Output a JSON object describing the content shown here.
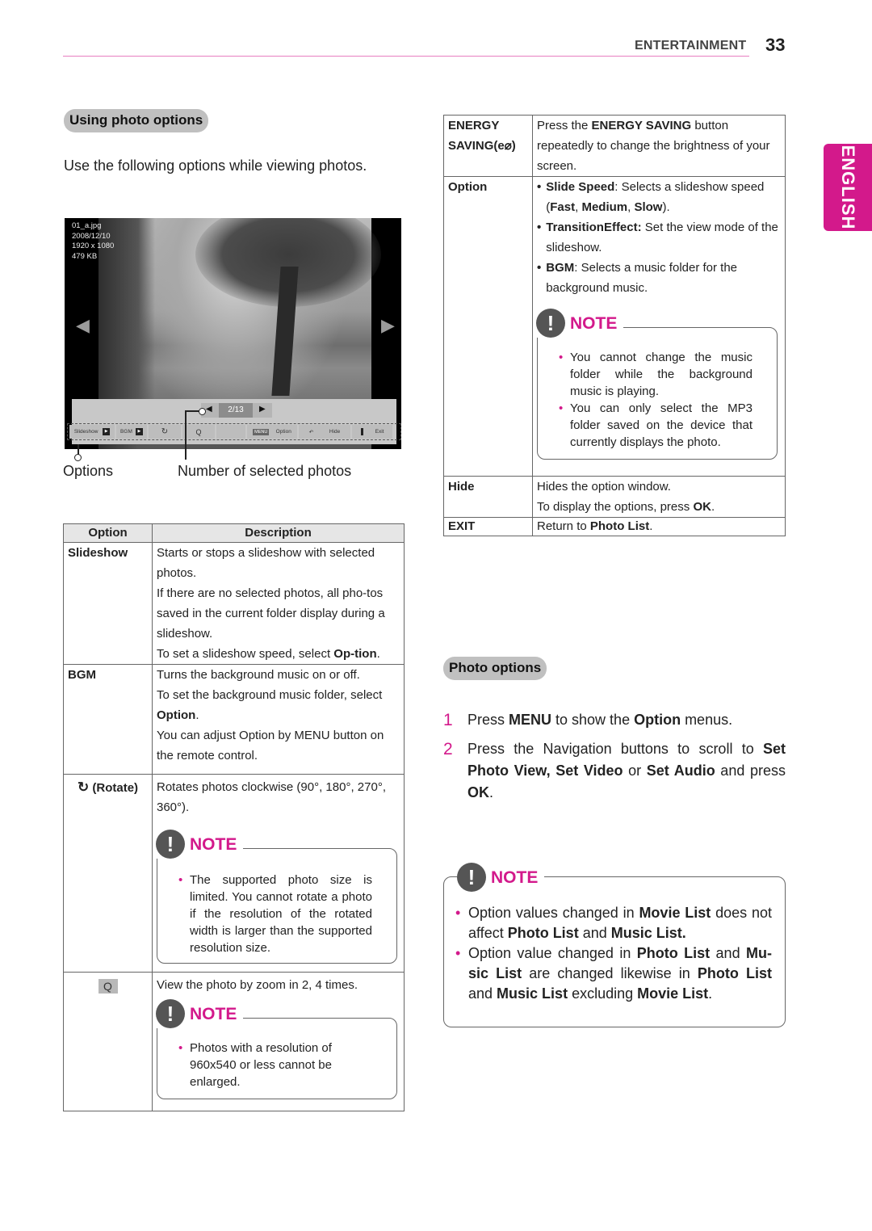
{
  "header": {
    "section": "ENTERTAINMENT",
    "page_number": "33",
    "language_tab": "ENGLISH",
    "accent_color": "#d3198b"
  },
  "using_photo_options": {
    "title": "Using photo options",
    "intro": "Use the following options while viewing photos."
  },
  "screen": {
    "file_name": "01_a.jpg",
    "date": "2008/12/10",
    "resolution": "1920 x 1080",
    "size": "479 KB",
    "counter": "2/13",
    "prev_arrow": "◀",
    "next_arrow": "▶",
    "options": {
      "slideshow": "Slideshow",
      "bgm": "BGM",
      "rotate_icon": "↻",
      "zoom_icon": "Q",
      "menu_key": "MENU",
      "option": "Option",
      "hide": "Hide",
      "exit": "Exit",
      "play_glyph": "▶"
    },
    "caption_options": "Options",
    "caption_number": "Number of selected photos"
  },
  "table_left": {
    "headers": [
      "Option",
      "Description"
    ],
    "slideshow": {
      "label": "Slideshow",
      "lines": [
        "Starts or stops a slideshow with selected photos.",
        "If there are no selected photos, all pho-tos saved in the current folder display during a slideshow."
      ],
      "line3_pre": "To set a slideshow speed, select ",
      "line3_bold": "Op-tion",
      "line3_post": "."
    },
    "bgm": {
      "label": "BGM",
      "line1": "Turns the background music on or off.",
      "line2_pre": "To set the background music folder, select ",
      "line2_bold": "Option",
      "line2_post": ".",
      "line3": "You can adjust Option by MENU button on the remote control."
    },
    "rotate": {
      "icon": "↻",
      "label": "(Rotate)",
      "desc": "Rotates photos clockwise (90°, 180°, 270°, 360°).",
      "note_title": "NOTE",
      "note_items": [
        "The supported photo size is limited. You cannot rotate a photo if the resolution of the rotated width is larger than the supported resolution size."
      ]
    },
    "zoom": {
      "icon": "Q",
      "desc": "View the photo by zoom in 2, 4 times.",
      "note_title": "NOTE",
      "note_items": [
        "Photos with a resolution of 960x540 or less cannot be enlarged."
      ]
    }
  },
  "table_right": {
    "energy": {
      "label1": "ENERGY",
      "label2": "SAVING(",
      "label_icon": "e⌀",
      "label3": ")",
      "desc_pre": "Press the ",
      "desc_bold": "ENERGY SAVING",
      "desc_post": " button repeatedly to change the brightness of your screen."
    },
    "option": {
      "label": "Option",
      "b1_bold": "Slide Speed",
      "b1_text": ": Selects a slideshow speed (",
      "b1_fast": "Fast",
      "b1_sep1": ", ",
      "b1_medium": "Medium",
      "b1_sep2": ", ",
      "b1_slow": "Slow",
      "b1_end": ").",
      "b2_bold": "TransitionEffect:",
      "b2_text": " Set the view mode of the slideshow.",
      "b3_bold": "BGM",
      "b3_text": ": Selects a music folder for the background music.",
      "bullet": "•",
      "note_title": "NOTE",
      "note_items": [
        "You cannot change the music folder while the background music is playing.",
        "You can only select the MP3 folder saved on the device that currently displays the photo."
      ]
    },
    "hide": {
      "label": "Hide",
      "line1": "Hides the option window.",
      "line2_pre": "To display the options, press ",
      "line2_bold": "OK",
      "line2_post": "."
    },
    "exit": {
      "label": "EXIT",
      "desc_pre": "Return to ",
      "desc_bold": "Photo List",
      "desc_post": "."
    }
  },
  "photo_options": {
    "title": "Photo options",
    "step1": {
      "n": "1",
      "t1": "Press ",
      "b1": "MENU",
      "t2": " to show the ",
      "b2": "Option",
      "t3": " menus."
    },
    "step2": {
      "n": "2",
      "t1": "Press the Navigation buttons to scroll to ",
      "b1": "Set Photo View, Set Video",
      "t2": " or ",
      "b2": "Set Audio",
      "t3": " and press ",
      "b3": "OK",
      "t4": "."
    },
    "note_title": "NOTE",
    "note1": {
      "t1": "Option values changed in ",
      "b1": "Movie List",
      "t2": " does not affect ",
      "b2": "Photo List",
      "t3": " and ",
      "b3": "Music List."
    },
    "note2": {
      "t1": "Option value changed in ",
      "b1": "Photo List",
      "t2": " and ",
      "b2": "Mu-sic List",
      "t3": " are changed likewise in ",
      "b3": "Photo List",
      "t4": " and ",
      "b4": "Music List",
      "t5": " excluding ",
      "b5": "Movie List",
      "t6": "."
    }
  }
}
